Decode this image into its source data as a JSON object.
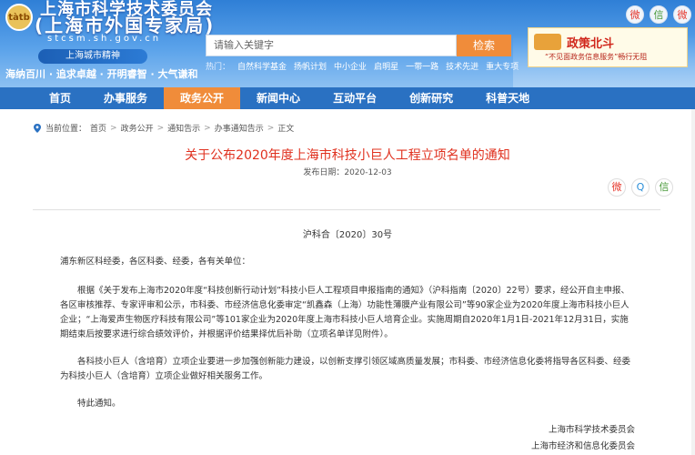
{
  "header": {
    "logo_text": "tàtb",
    "site_title": "上海市科学技术委员会",
    "site_subtitle": "(上海市外国专家局)",
    "domain": "stcsm.sh.gov.cn",
    "spirit_label": "上海城市精神",
    "spirit_text": "海纳百川 · 追求卓越 · 开明睿智 · 大气谦和"
  },
  "search": {
    "placeholder": "请输入关键字",
    "button_label": "检索",
    "hot_label": "热门：",
    "hot_links": [
      "自然科学基金",
      "扬帆计划",
      "中小企业",
      "启明星",
      "一带一路",
      "技术先进",
      "重大专项"
    ]
  },
  "social": {
    "weibo": "微",
    "wechat": "信",
    "other": "微"
  },
  "policy_banner": {
    "title": "政策北斗",
    "subtitle": "“不见面政务信息服务”畅行无阻"
  },
  "nav": {
    "items": [
      "首页",
      "办事服务",
      "政务公开",
      "新闻中心",
      "互动平台",
      "创新研究",
      "科普天地"
    ],
    "active_index": 2
  },
  "breadcrumb": {
    "prefix": "当前位置：",
    "items": [
      "首页",
      "政务公开",
      "通知告示",
      "办事通知告示",
      "正文"
    ]
  },
  "article": {
    "title": "关于公布2020年度上海市科技小巨人工程立项名单的通知",
    "pubdate": "发布日期：2020-12-03",
    "doc_no": "沪科合〔2020〕30号",
    "greeting": "浦东新区科经委，各区科委、经委，各有关单位：",
    "para1": "根据《关于发布上海市2020年度“科技创新行动计划”科技小巨人工程项目申报指南的通知》（沪科指南〔2020〕22号）要求，经公开自主申报、各区审核推荐、专家评审和公示，市科委、市经济信息化委审定“凯鑫森（上海）功能性薄膜产业有限公司”等90家企业为2020年度上海市科技小巨人企业；“上海爱声生物医疗科技有限公司”等101家企业为2020年度上海市科技小巨人培育企业。实施周期自2020年1月1日-2021年12月31日，实施期结束后按要求进行综合绩效评价，并根据评价结果择优后补助（立项名单详见附件）。",
    "para2": "各科技小巨人（含培育）立项企业要进一步加强创新能力建设，以创新支撑引领区域高质量发展；市科委、市经济信息化委将指导各区科委、经委为科技小巨人（含培育）立项企业做好相关服务工作。",
    "closing": "特此通知。",
    "signers": [
      "上海市科学技术委员会",
      "上海市经济和信息化委员会"
    ]
  },
  "share": {
    "weibo": "微",
    "qq": "Q",
    "wechat": "信"
  },
  "colors": {
    "nav_bg": "#2a71c2",
    "accent": "#f08c3a",
    "title_red": "#e0301e"
  }
}
